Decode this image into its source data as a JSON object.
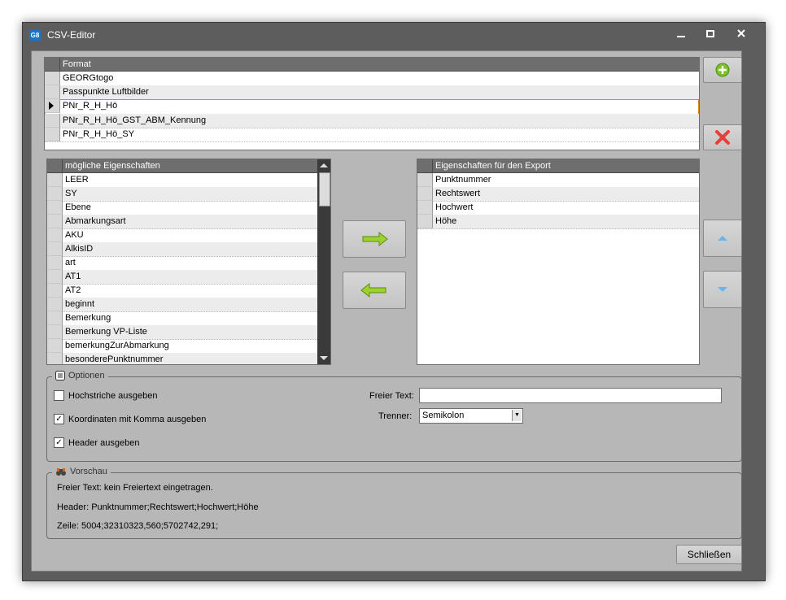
{
  "window": {
    "title": "CSV-Editor",
    "app_icon_text": "G8"
  },
  "format_grid": {
    "header": "Format",
    "rows": [
      "GEORGtogo",
      "Passpunkte Luftbilder",
      "PNr_R_H_Hö",
      "PNr_R_H_Hö_GST_ABM_Kennung",
      "PNr_R_H_Hö_SY"
    ]
  },
  "possible_grid": {
    "header": "mögliche Eigenschaften",
    "rows": [
      "LEER",
      "SY",
      "Ebene",
      "Abmarkungsart",
      "AKU",
      "AlkisID",
      "art",
      "AT1",
      "AT2",
      "beginnt",
      "Bemerkung",
      "Bemerkung VP-Liste",
      "bemerkungZurAbmarkung",
      "besonderePunktnummer"
    ]
  },
  "export_grid": {
    "header": "Eigenschaften für den Export",
    "rows": [
      "Punktnummer",
      "Rechtswert",
      "Hochwert",
      "Höhe"
    ]
  },
  "options": {
    "legend": "Optionen",
    "hochstriche_label": "Hochstriche ausgeben",
    "koordinaten_label": "Koordinaten mit Komma ausgeben",
    "header_label": "Header ausgeben",
    "freier_text_label": "Freier Text:",
    "freier_text_value": "",
    "trenner_label": "Trenner:",
    "trenner_value": "Semikolon"
  },
  "preview": {
    "legend": "Vorschau",
    "line1": "Freier Text: kein Freiertext eingetragen.",
    "line2": "Header: Punktnummer;Rechtswert;Hochwert;Höhe",
    "line3": "Zeile: 5004;32310323,560;5702742,291;"
  },
  "close_button": "Schließen"
}
